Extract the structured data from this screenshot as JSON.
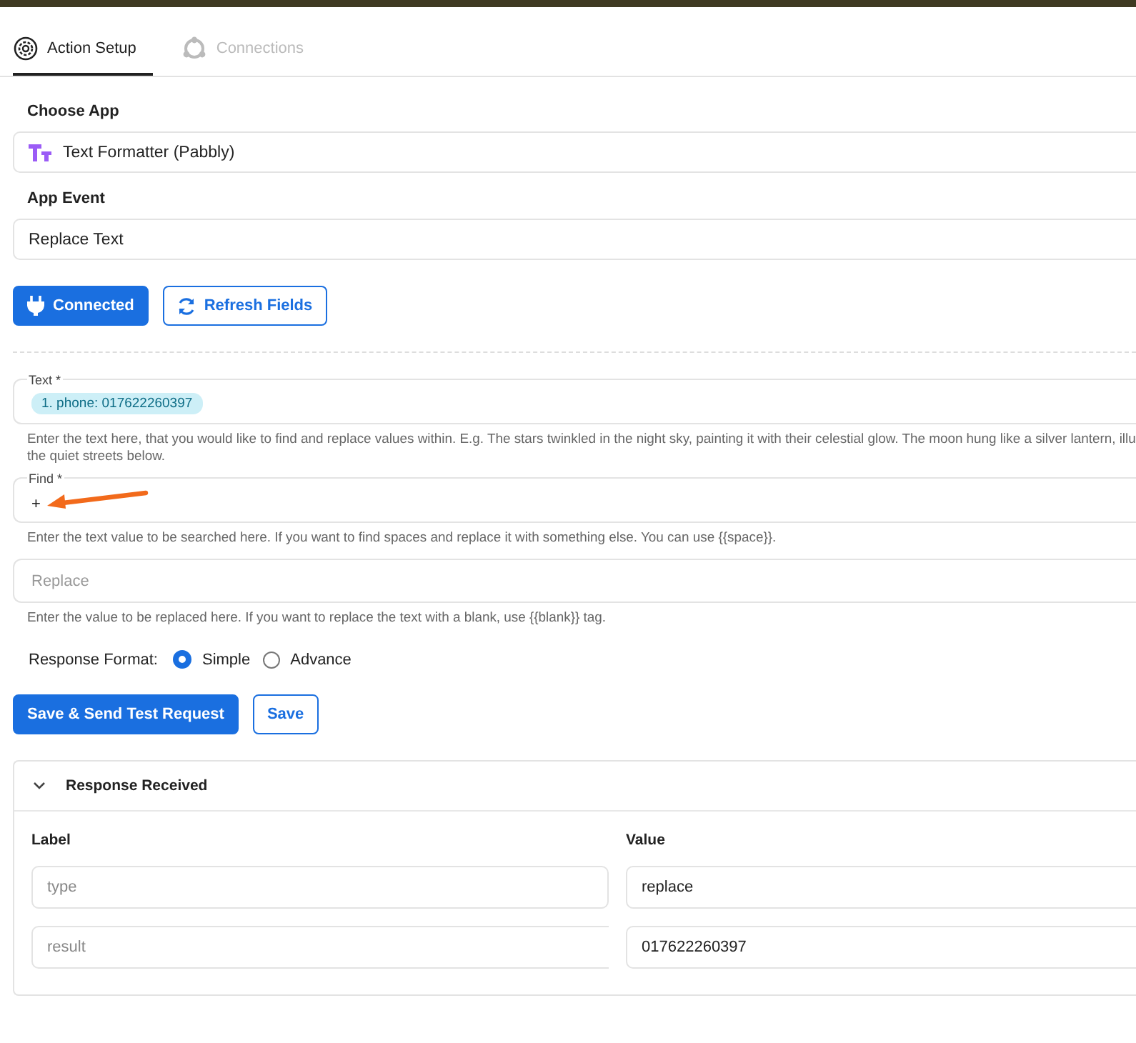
{
  "tabs": [
    {
      "label": "Action Setup",
      "selected": true,
      "kind": "setup"
    },
    {
      "label": "Connections",
      "selected": false,
      "kind": "connections"
    }
  ],
  "choose_app": {
    "label": "Choose App",
    "value": "Text Formatter (Pabbly)"
  },
  "app_event": {
    "label": "App Event",
    "value": "Replace Text"
  },
  "buttons": {
    "connected": "Connected",
    "refresh": "Refresh Fields"
  },
  "fields": [
    {
      "label": "Text *",
      "tag": "1. phone: 017622260397",
      "help": [
        "Enter the text here, that you would like to find and replace values within. E.g. The stars twinkled in the night sky, painting it with their celestial glow. The moon hung like a silver lantern, illu",
        "the quiet streets below."
      ]
    },
    {
      "label": "Find *",
      "value": "+",
      "help": [
        "Enter the text value to be searched here. If you want to find spaces and replace it with something else. You can use {{space}}."
      ]
    },
    {
      "placeholder": "Replace",
      "help": [
        "Enter the value to be replaced here. If you want to replace the text with a blank, use {{blank}} tag."
      ]
    }
  ],
  "response_format": {
    "label": "Response Format:",
    "options": [
      {
        "label": "Simple",
        "selected": true
      },
      {
        "label": "Advance",
        "selected": false
      }
    ]
  },
  "actions": {
    "primary": "Save & Send Test Request",
    "secondary": "Save"
  },
  "response": {
    "title": "Response Received",
    "expanded": true,
    "columns": [
      "Label",
      "Value"
    ],
    "rows": [
      {
        "label": "type",
        "value": "replace"
      },
      {
        "label": "result",
        "value": "017622260397"
      }
    ]
  }
}
